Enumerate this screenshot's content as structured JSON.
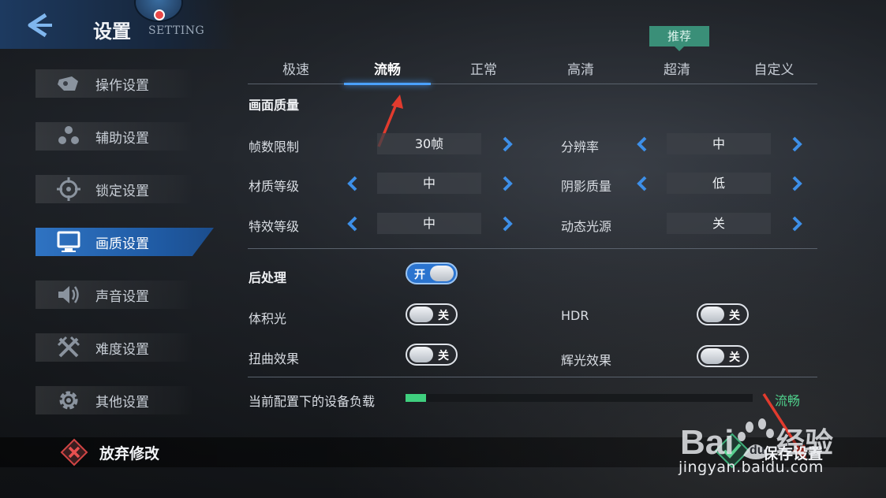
{
  "header": {
    "title": "设置",
    "subtitle": "SETTING"
  },
  "sidebar": {
    "items": [
      {
        "label": "操作设置",
        "icon": "gamepad-icon"
      },
      {
        "label": "辅助设置",
        "icon": "dots-icon"
      },
      {
        "label": "锁定设置",
        "icon": "crosshair-icon"
      },
      {
        "label": "画质设置",
        "icon": "monitor-icon",
        "active": true
      },
      {
        "label": "声音设置",
        "icon": "speaker-icon"
      },
      {
        "label": "难度设置",
        "icon": "crossed-swords-icon"
      },
      {
        "label": "其他设置",
        "icon": "gear-icon"
      }
    ]
  },
  "tabs": [
    {
      "label": "极速"
    },
    {
      "label": "流畅",
      "active": true
    },
    {
      "label": "正常"
    },
    {
      "label": "高清"
    },
    {
      "label": "超清"
    },
    {
      "label": "自定义"
    }
  ],
  "recommend_badge": "推荐",
  "quality": {
    "section_title": "画面质量",
    "frame_limit": {
      "label": "帧数限制",
      "value": "30帧"
    },
    "resolution": {
      "label": "分辨率",
      "value": "中"
    },
    "texture": {
      "label": "材质等级",
      "value": "中"
    },
    "shadow": {
      "label": "阴影质量",
      "value": "低"
    },
    "effects": {
      "label": "特效等级",
      "value": "中"
    },
    "dynamic_light": {
      "label": "动态光源",
      "value": "关"
    }
  },
  "post": {
    "section_title": "后处理",
    "toggle_text": "开",
    "volumetric": {
      "label": "体积光",
      "toggle_text": "关"
    },
    "hdr": {
      "label": "HDR",
      "toggle_text": "关"
    },
    "distortion": {
      "label": "扭曲效果",
      "toggle_text": "关"
    },
    "bloom": {
      "label": "辉光效果",
      "toggle_text": "关"
    }
  },
  "load": {
    "label": "当前配置下的设备负载",
    "fraction": 0.06,
    "status": "流畅",
    "fill_color": "#3fcf7e"
  },
  "footer": {
    "discard_label": "放弃修改",
    "save_label": "保存设置"
  },
  "watermark": {
    "url": "jingyan.baidu.com"
  },
  "colors": {
    "accent": "#2f73c2",
    "recommend": "#3a8f78",
    "annotation": "#e23b2e"
  }
}
